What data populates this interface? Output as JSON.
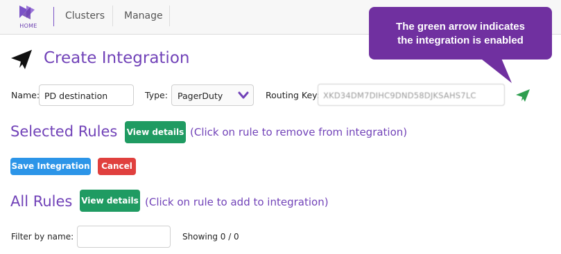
{
  "header": {
    "logo_text": "HOME",
    "nav": [
      "Clusters",
      "Manage"
    ]
  },
  "page": {
    "title": "Create Integration",
    "title_icon": "send-icon"
  },
  "form": {
    "name_label": "Name:",
    "name_value": "PD destination",
    "type_label": "Type:",
    "type_value": "PagerDuty",
    "routing_label": "Routing Key:",
    "routing_value": "XKD34DM7DIHC9DND58DJKSAHS7LC",
    "status_icon": "send-icon",
    "status_color": "#2e9e4f"
  },
  "selected_rules": {
    "heading": "Selected Rules",
    "button": "View details",
    "hint": "(Click on rule to remove from integration)"
  },
  "actions": {
    "save": "Save Integration",
    "cancel": "Cancel"
  },
  "all_rules": {
    "heading": "All Rules",
    "button": "View details",
    "hint": "(Click on rule to add to integration)"
  },
  "filter": {
    "label": "Filter by name:",
    "value": "",
    "showing": "Showing 0 / 0"
  },
  "callout": {
    "line1": "The green arrow indicates",
    "line2": "the integration is enabled"
  },
  "colors": {
    "accent": "#7142b8",
    "green": "#1f9b62",
    "blue": "#2c95e8",
    "red": "#e0403e",
    "callout": "#7030a0"
  }
}
